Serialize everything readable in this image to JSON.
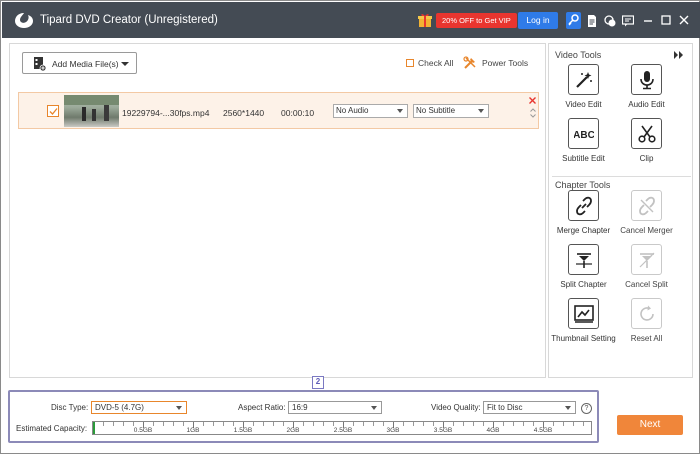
{
  "titlebar": {
    "app_title": "Tipard DVD Creator (Unregistered)",
    "promo": "20% OFF to Get VIP",
    "login": "Log in",
    "icons": [
      "gift-icon",
      "key-icon",
      "document-icon",
      "chat-icon",
      "feedback-icon",
      "minimize-icon",
      "maximize-icon",
      "close-icon"
    ]
  },
  "toolbar": {
    "add_media": "Add Media File(s)",
    "check_all": "Check All",
    "power_tools": "Power Tools"
  },
  "media_list": [
    {
      "checked": true,
      "file_name": "19229794-...30fps.mp4",
      "resolution": "2560*1440",
      "duration": "00:00:10",
      "audio": "No Audio",
      "subtitle": "No Subtitle"
    }
  ],
  "video_tools": {
    "title": "Video Tools",
    "items": [
      {
        "label": "Video Edit",
        "icon": "magic-wand-icon",
        "enabled": true
      },
      {
        "label": "Audio Edit",
        "icon": "microphone-icon",
        "enabled": true
      },
      {
        "label": "Subtitle Edit",
        "icon": "abc-text-icon",
        "enabled": true
      },
      {
        "label": "Clip",
        "icon": "scissors-icon",
        "enabled": true
      }
    ]
  },
  "chapter_tools": {
    "title": "Chapter Tools",
    "items": [
      {
        "label": "Merge Chapter",
        "icon": "link-icon",
        "enabled": true
      },
      {
        "label": "Cancel Merger",
        "icon": "unlink-icon",
        "enabled": false
      },
      {
        "label": "Split Chapter",
        "icon": "split-icon",
        "enabled": true
      },
      {
        "label": "Cancel Split",
        "icon": "cancel-split-icon",
        "enabled": false
      },
      {
        "label": "Thumbnail Setting",
        "icon": "thumbnail-icon",
        "enabled": true
      },
      {
        "label": "Reset All",
        "icon": "reset-icon",
        "enabled": false
      }
    ]
  },
  "settings": {
    "badge": "2",
    "disc_type_label": "Disc Type:",
    "disc_type_value": "DVD-5 (4.7G)",
    "aspect_ratio_label": "Aspect Ratio:",
    "aspect_ratio_value": "16:9",
    "video_quality_label": "Video Quality:",
    "video_quality_value": "Fit to Disc",
    "help": "?",
    "capacity_label": "Estimated Capacity:",
    "capacity_ticks": [
      "0.5GB",
      "1GB",
      "1.5GB",
      "2GB",
      "2.5GB",
      "3GB",
      "3.5GB",
      "4GB",
      "4.5GB"
    ],
    "capacity_used_fraction": 0.0
  },
  "next_button": "Next",
  "colors": {
    "titlebar": "#444b54",
    "accent_orange": "#f0863a",
    "login_blue": "#2f7be8",
    "promo_red": "#e8352f",
    "highlight_purple": "#8c8ab8"
  }
}
